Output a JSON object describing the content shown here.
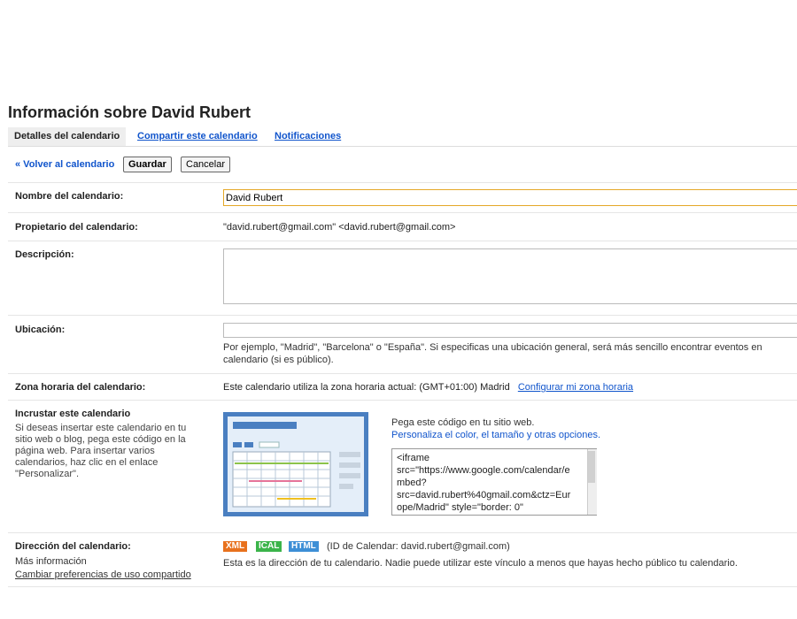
{
  "page": {
    "title": "Información sobre David Rubert"
  },
  "tabs": [
    {
      "label": "Detalles del calendario",
      "active": true
    },
    {
      "label": "Compartir este calendario",
      "active": false
    },
    {
      "label": "Notificaciones",
      "active": false
    }
  ],
  "actions": {
    "back": "« Volver al calendario",
    "save": "Guardar",
    "cancel": "Cancelar"
  },
  "fields": {
    "name": {
      "label": "Nombre del calendario:",
      "value": "David Rubert"
    },
    "owner": {
      "label": "Propietario del calendario:",
      "value": "\"david.rubert@gmail.com\" <david.rubert@gmail.com>"
    },
    "description": {
      "label": "Descripción:",
      "value": ""
    },
    "location": {
      "label": "Ubicación:",
      "value": "",
      "hint": "Por ejemplo, \"Madrid\", \"Barcelona\" o \"España\". Si especificas una ubicación general, será más sencillo encontrar eventos en calendario (si es público)."
    },
    "timezone": {
      "label": "Zona horaria del calendario:",
      "text": "Este calendario utiliza la zona horaria actual:   (GMT+01:00) Madrid",
      "link": "Configurar mi zona horaria"
    },
    "embed": {
      "label": "Incrustar este calendario",
      "help": "Si deseas insertar este calendario en tu sitio web o blog, pega este código en la página web. Para insertar varios calendarios, haz clic en el enlace \"Personalizar\".",
      "paste_text": "Pega este código en tu sitio web.",
      "customize_link": "Personaliza el color, el tamaño y otras opciones.",
      "code": "<iframe\nsrc=\"https://www.google.com/calendar/e\nmbed?\nsrc=david.rubert%40gmail.com&ctz=Eur\nope/Madrid\" style=\"border: 0\""
    },
    "address": {
      "label": "Dirección del calendario:",
      "more_info": "Más información",
      "change_sharing": "Cambiar preferencias de uso compartido",
      "badges": [
        {
          "label": "XML",
          "color": "#e8711d"
        },
        {
          "label": "ICAL",
          "color": "#3bb44a"
        },
        {
          "label": "HTML",
          "color": "#3d8fd6"
        }
      ],
      "calendar_id": "(ID de Calendar: david.rubert@gmail.com)",
      "note": "Esta es la dirección de tu calendario. Nadie puede utilizar este vínculo a menos que hayas hecho público tu calendario."
    }
  }
}
